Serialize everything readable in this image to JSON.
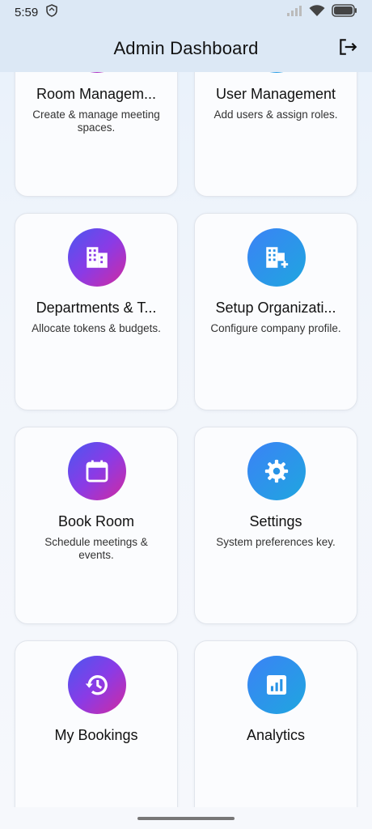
{
  "status_bar": {
    "time": "5:59"
  },
  "app_bar": {
    "title": "Admin Dashboard"
  },
  "cards": [
    {
      "title": "Room Managem...",
      "description": "Create & manage meeting spaces.",
      "icon": "door-icon",
      "style": "purple"
    },
    {
      "title": "User Management",
      "description": "Add users & assign roles.",
      "icon": "group-icon",
      "style": "blue"
    },
    {
      "title": "Departments & T...",
      "description": "Allocate tokens & budgets.",
      "icon": "building-icon",
      "style": "purple"
    },
    {
      "title": "Setup Organizati...",
      "description": "Configure company profile.",
      "icon": "building-add-icon",
      "style": "blue"
    },
    {
      "title": "Book Room",
      "description": "Schedule meetings & events.",
      "icon": "calendar-icon",
      "style": "purple"
    },
    {
      "title": "Settings",
      "description": "System preferences key.",
      "icon": "gear-icon",
      "style": "blue"
    },
    {
      "title": "My Bookings",
      "description": "",
      "icon": "history-icon",
      "style": "purple"
    },
    {
      "title": "Analytics",
      "description": "",
      "icon": "analytics-icon",
      "style": "blue"
    }
  ]
}
